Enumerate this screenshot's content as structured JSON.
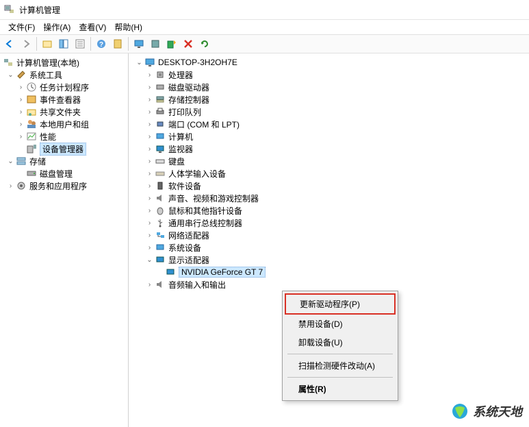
{
  "title": "计算机管理",
  "menu": {
    "file": "文件(F)",
    "action": "操作(A)",
    "view": "查看(V)",
    "help": "帮助(H)"
  },
  "left_tree": {
    "root": "计算机管理(本地)",
    "sys_tools": "系统工具",
    "task_sched": "任务计划程序",
    "event_viewer": "事件查看器",
    "shared": "共享文件夹",
    "local_users": "本地用户和组",
    "perf": "性能",
    "dev_mgr": "设备管理器",
    "storage": "存储",
    "disk_mgmt": "磁盘管理",
    "services": "服务和应用程序"
  },
  "right_tree": {
    "computer": "DESKTOP-3H2OH7E",
    "cpu": "处理器",
    "disk_drives": "磁盘驱动器",
    "storage_ctrl": "存储控制器",
    "print_queue": "打印队列",
    "ports": "端口 (COM 和 LPT)",
    "computers": "计算机",
    "monitors": "监视器",
    "keyboards": "键盘",
    "hid": "人体学输入设备",
    "software": "软件设备",
    "sound": "声音、视频和游戏控制器",
    "mouse": "鼠标和其他指针设备",
    "usb": "通用串行总线控制器",
    "network": "网络适配器",
    "sys_dev": "系统设备",
    "display": "显示适配器",
    "gpu": "NVIDIA GeForce GT 7",
    "audio": "音频输入和输出"
  },
  "context_menu": {
    "update": "更新驱动程序(P)",
    "disable": "禁用设备(D)",
    "uninstall": "卸载设备(U)",
    "scan": "扫描检测硬件改动(A)",
    "props": "属性(R)"
  },
  "watermark": "系统天地"
}
